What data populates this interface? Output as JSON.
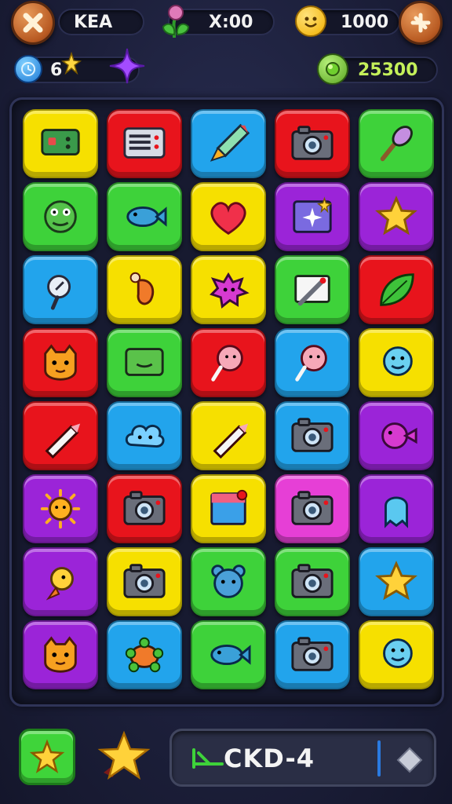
{
  "hud": {
    "close_icon": "close-icon",
    "player_name": "KEA",
    "flower_icon": "flower-icon",
    "timer": "X:00",
    "coin_icon": "smiley-coin-icon",
    "coins": "1000",
    "add_icon": "plus-icon",
    "moves": "6",
    "sparkle_icon": "purple-star-icon",
    "gem_icon": "green-gem-icon",
    "score": "25300"
  },
  "colors": {
    "yellow": "#f6e000",
    "red": "#e8141c",
    "blue": "#22a4ec",
    "green": "#3ed23a",
    "purple": "#9b24d8",
    "magenta": "#e63fd6"
  },
  "board": {
    "rows": [
      [
        "yellow:monitor-icon",
        "red:calendar-icon",
        "blue:rocket-icon",
        "red:camera-icon",
        "green:brush-icon"
      ],
      [
        "green:monster-icon",
        "green:fish-icon",
        "yellow:heart-icon",
        "purple:picture-sparkle-icon",
        "purple:star-icon"
      ],
      [
        "blue:magnifier-icon",
        "yellow:chicken-leg-icon",
        "yellow:spiky-creature-icon",
        "green:picture-pencil-icon",
        "red:leaf-icon"
      ],
      [
        "red:cat-face-icon",
        "green:monitor-smile-icon",
        "red:lollipop-icon",
        "blue:lollipop-icon",
        "yellow:smiley-icon"
      ],
      [
        "red:pencil-icon",
        "blue:cloud-face-icon",
        "yellow:pencil-icon",
        "blue:camera-icon",
        "purple:puffer-fish-icon"
      ],
      [
        "purple:sun-face-icon",
        "red:camera-icon",
        "yellow:picture-icon",
        "magenta:camera-icon",
        "purple:ghost-icon"
      ],
      [
        "purple:chick-icon",
        "yellow:camera-icon",
        "green:bear-face-icon",
        "green:camera-icon",
        "blue:star-icon"
      ],
      [
        "purple:cat-face-icon",
        "blue:turtle-icon",
        "green:fish-icon",
        "blue:camera-icon",
        "yellow:smiley-icon"
      ]
    ]
  },
  "bottom": {
    "hint_icon": "hand-star-icon",
    "star_icon": "star-icon",
    "code": "CKD-4",
    "arrow_icon": "green-arrow-icon",
    "diamond_icon": "diamond-icon"
  }
}
